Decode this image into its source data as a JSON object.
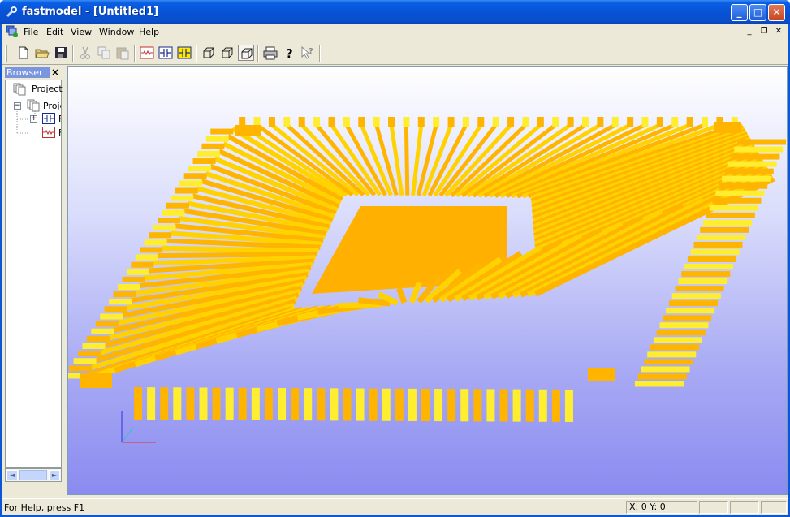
{
  "window": {
    "title": "fastmodel - [Untitled1]",
    "controls": {
      "minimize": "_",
      "maximize": "□",
      "close": "✕"
    }
  },
  "menubar": {
    "items": [
      "File",
      "Edit",
      "View",
      "Window",
      "Help"
    ],
    "mdi_controls": {
      "minimize": "_",
      "restore": "❐",
      "close": "✕"
    }
  },
  "toolbar": {
    "buttons": [
      "new-document-icon",
      "open-folder-icon",
      "save-icon",
      "cut-icon",
      "copy-icon",
      "paste-icon",
      "resistor-view-icon",
      "capacitor-view-icon",
      "inductor-view-icon",
      "box-view-1-icon",
      "box-view-2-icon",
      "box-view-3-icon",
      "print-icon",
      "help-icon",
      "context-help-icon"
    ],
    "pressed": "box-view-3-icon"
  },
  "browser": {
    "header": "Browser",
    "close": "×",
    "tab_label": "Project",
    "tree": {
      "root_label": "Proje",
      "child1_label": "F",
      "child2_label": "F",
      "expander": "+",
      "collapser": "−"
    },
    "scroll_left": "◄",
    "scroll_right": "►"
  },
  "viewport": {
    "leads": [
      {
        "count": 34,
        "color": "#ffb400",
        "highlight": "#ffe600"
      }
    ],
    "colors": {
      "lead": "#ffb400",
      "lead_light": "#ffd200",
      "lead_top": "#ffee30",
      "die": "#ffb000",
      "bg_top": "#ffffff",
      "bg_bottom": "#8a8bf0"
    }
  },
  "statusbar": {
    "help_text": "For Help, press F1",
    "coords": "X: 0  Y: 0"
  }
}
